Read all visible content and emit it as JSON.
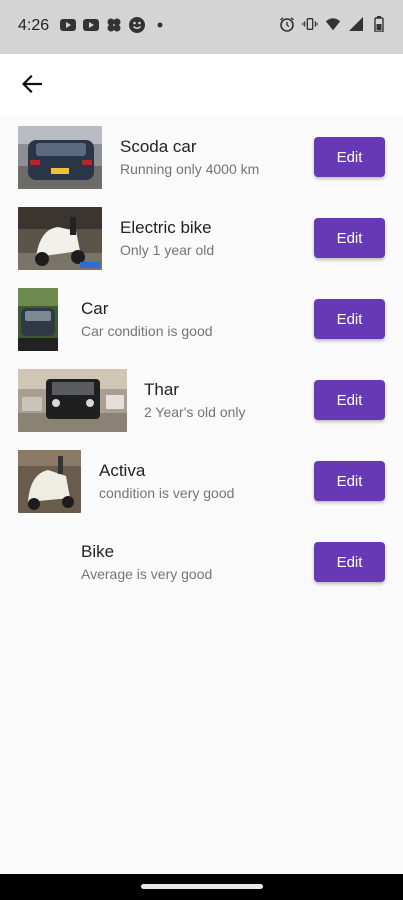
{
  "status_bar": {
    "time": "4:26",
    "left_icons": [
      "youtube-icon",
      "youtube-icon",
      "pinwheel-icon",
      "smiley-icon",
      "dot-icon"
    ],
    "right_icons": [
      "alarm-icon",
      "vibrate-icon",
      "wifi-icon",
      "signal-icon",
      "battery-icon"
    ]
  },
  "app_bar": {
    "back_icon": "arrow-back-icon"
  },
  "colors": {
    "accent": "#6739b7",
    "status_bar_bg": "#d4d4d4",
    "background": "#fafafa"
  },
  "items": [
    {
      "title": "Scoda car",
      "subtitle": "Running only 4000 km",
      "edit_label": "Edit"
    },
    {
      "title": "Electric bike",
      "subtitle": "Only 1 year old",
      "edit_label": "Edit"
    },
    {
      "title": "Car",
      "subtitle": "Car condition is good",
      "edit_label": "Edit"
    },
    {
      "title": "Thar",
      "subtitle": "2 Year's old only",
      "edit_label": "Edit"
    },
    {
      "title": "Activa",
      "subtitle": "condition is very good",
      "edit_label": "Edit"
    },
    {
      "title": "Bike",
      "subtitle": "Average is very good",
      "edit_label": "Edit"
    }
  ]
}
